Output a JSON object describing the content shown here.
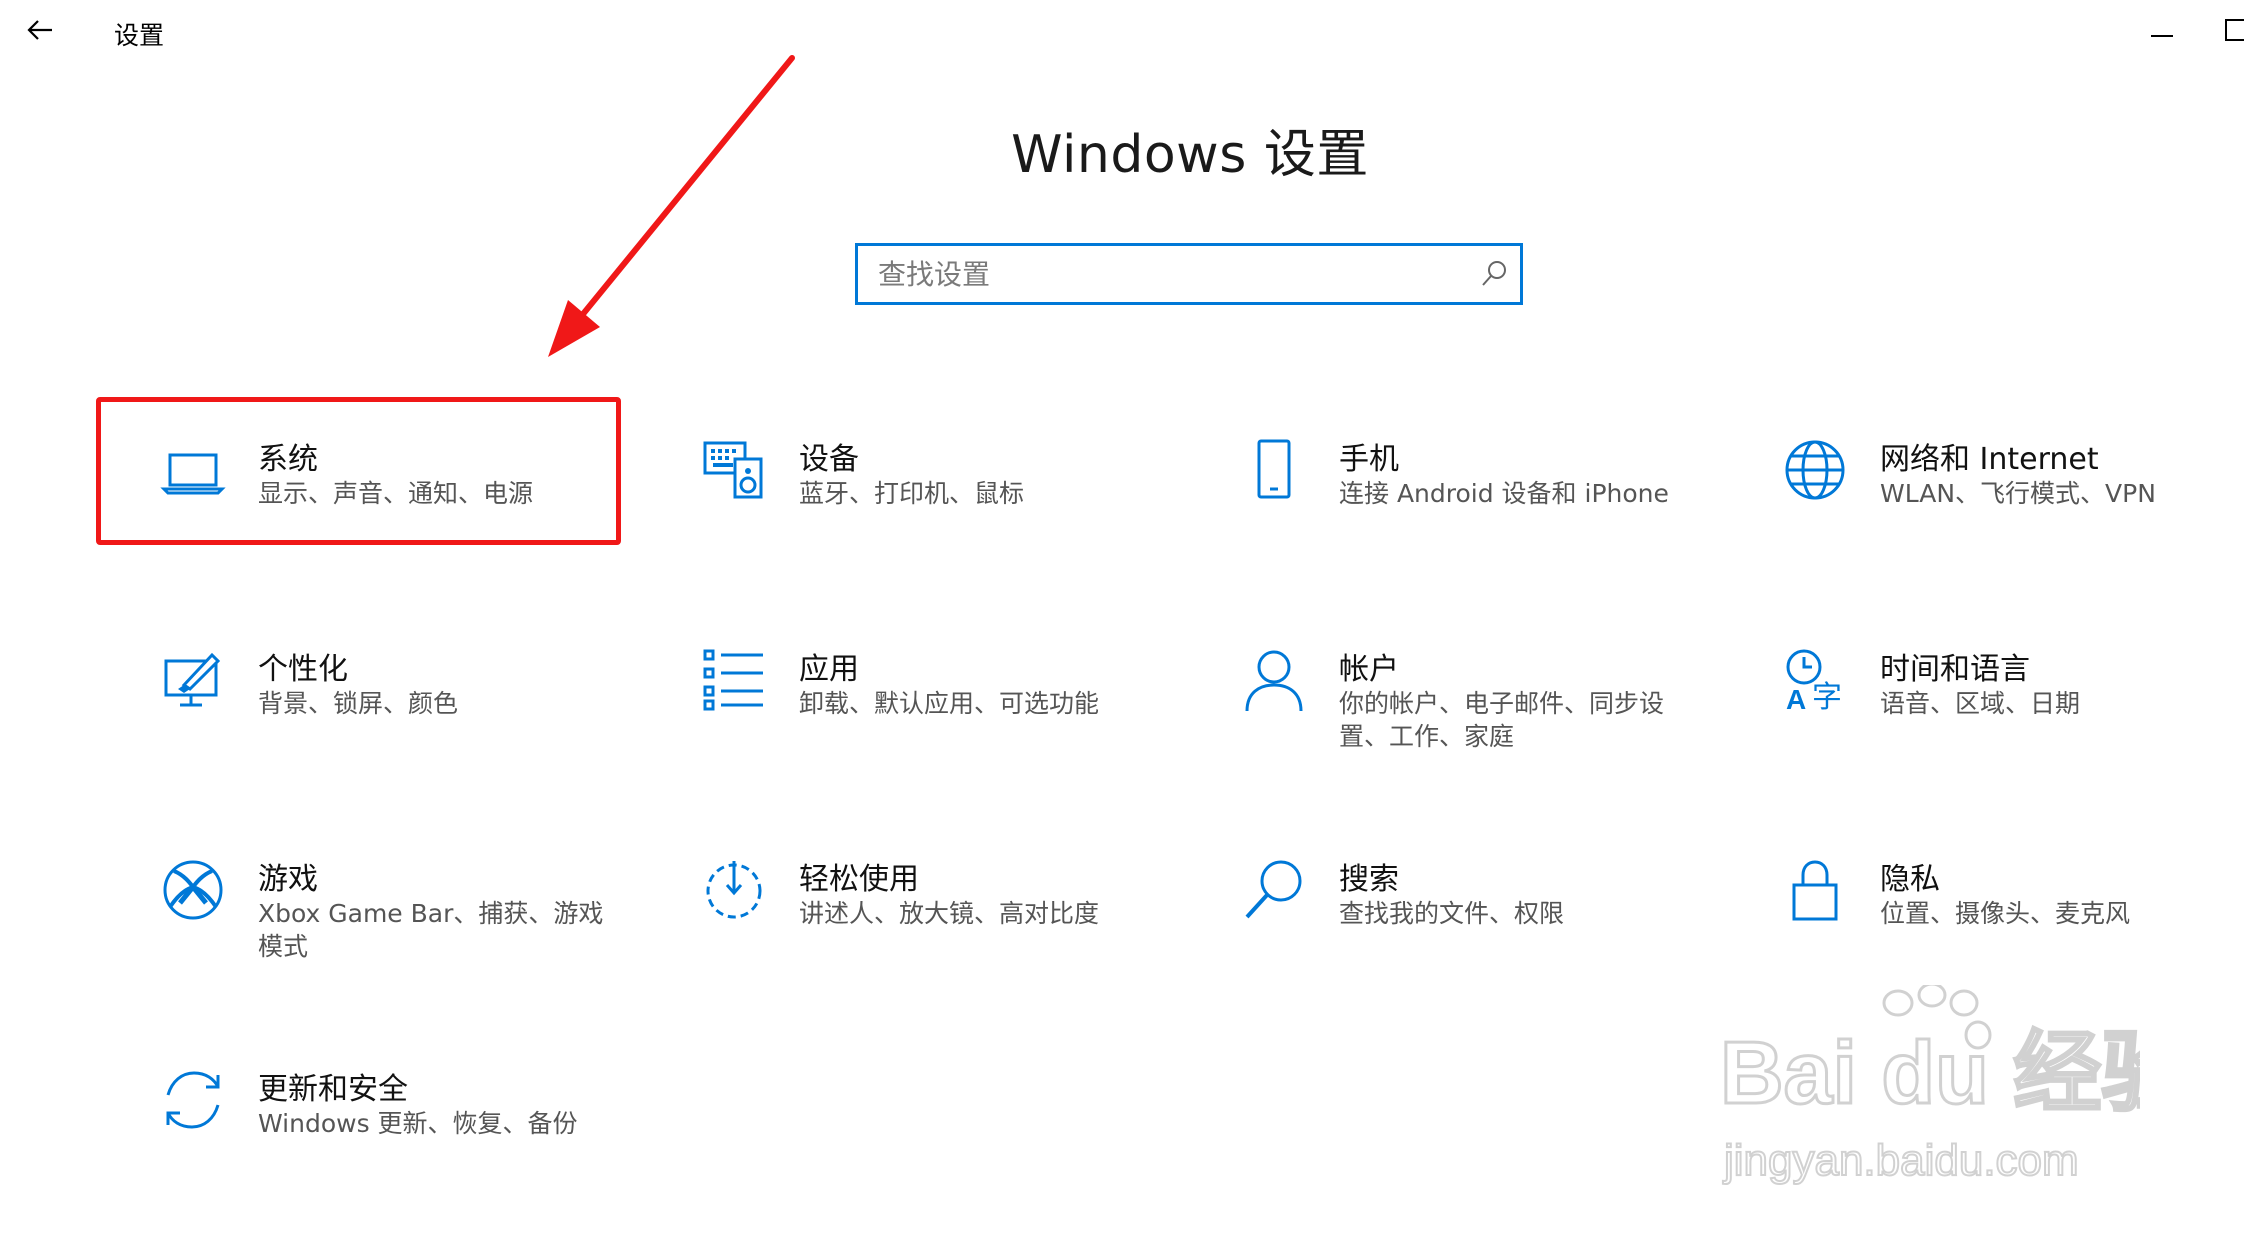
{
  "window": {
    "title": "设置",
    "back_icon": "arrow-left-icon",
    "minimize_icon": "minimize-icon",
    "maximize_icon": "maximize-icon"
  },
  "header": {
    "title": "Windows 设置"
  },
  "search": {
    "placeholder": "查找设置",
    "value": "",
    "icon": "search-icon"
  },
  "tiles": [
    {
      "id": "system",
      "title": "系统",
      "desc": "显示、声音、通知、电源",
      "icon": "laptop-icon",
      "highlighted": true
    },
    {
      "id": "devices",
      "title": "设备",
      "desc": "蓝牙、打印机、鼠标",
      "icon": "keyboard-speaker-icon"
    },
    {
      "id": "phone",
      "title": "手机",
      "desc": "连接 Android 设备和 iPhone",
      "icon": "phone-icon"
    },
    {
      "id": "network",
      "title": "网络和 Internet",
      "desc": "WLAN、飞行模式、VPN",
      "icon": "globe-icon"
    },
    {
      "id": "personalization",
      "title": "个性化",
      "desc": "背景、锁屏、颜色",
      "icon": "paint-monitor-icon"
    },
    {
      "id": "apps",
      "title": "应用",
      "desc": "卸载、默认应用、可选功能",
      "icon": "apps-list-icon"
    },
    {
      "id": "accounts",
      "title": "帐户",
      "desc": "你的帐户、电子邮件、同步设置、工作、家庭",
      "icon": "person-icon"
    },
    {
      "id": "time_language",
      "title": "时间和语言",
      "desc": "语音、区域、日期",
      "icon": "time-language-icon"
    },
    {
      "id": "gaming",
      "title": "游戏",
      "desc": "Xbox Game Bar、捕获、游戏模式",
      "icon": "xbox-icon"
    },
    {
      "id": "ease_of_access",
      "title": "轻松使用",
      "desc": "讲述人、放大镜、高对比度",
      "icon": "ease-of-access-icon"
    },
    {
      "id": "search",
      "title": "搜索",
      "desc": "查找我的文件、权限",
      "icon": "magnifier-icon"
    },
    {
      "id": "privacy",
      "title": "隐私",
      "desc": "位置、摄像头、麦克风",
      "icon": "lock-icon"
    },
    {
      "id": "update_security",
      "title": "更新和安全",
      "desc": "Windows 更新、恢复、备份",
      "icon": "sync-arrows-icon"
    }
  ],
  "annotation": {
    "arrow_color": "#f01818",
    "box_color": "#f01818"
  },
  "watermark": {
    "brand": "Bai du 经验",
    "url": "jingyan.baidu.com"
  },
  "colors": {
    "accent": "#0078d7",
    "title_text": "#111111",
    "desc_text": "#555555"
  }
}
